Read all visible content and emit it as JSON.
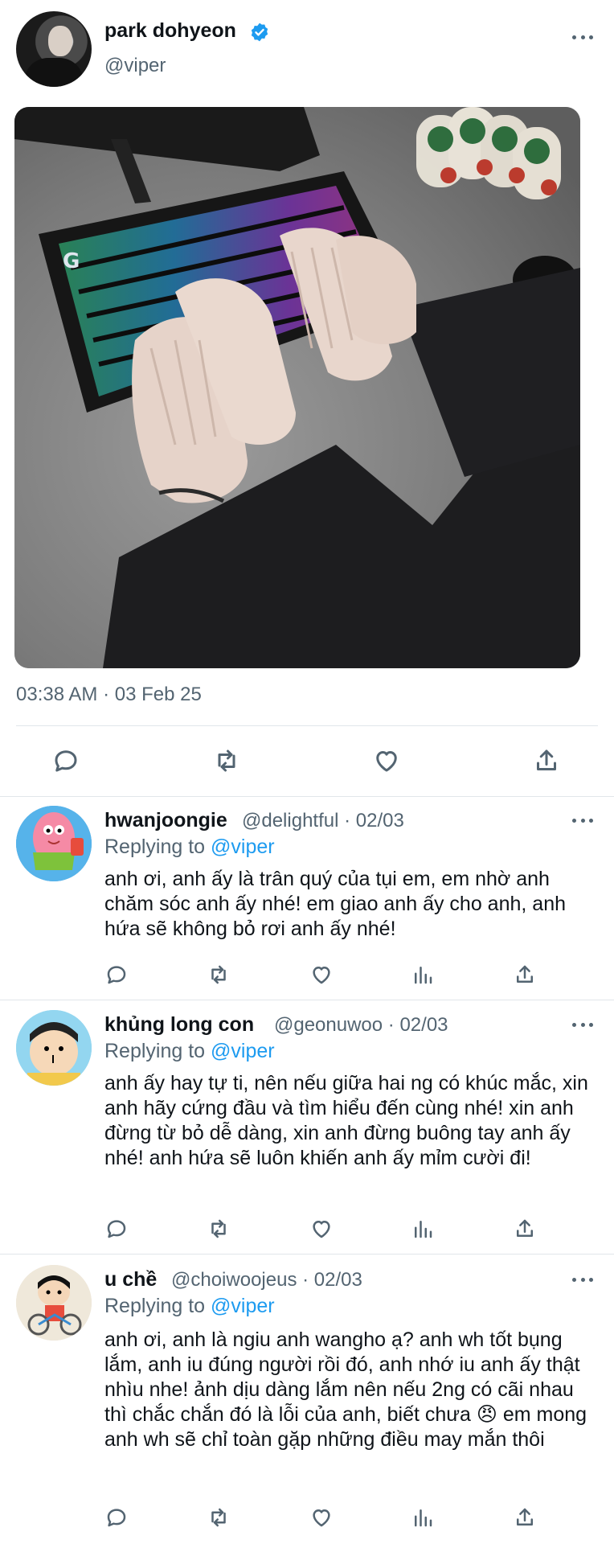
{
  "post": {
    "display_name": "park dohyeon",
    "handle": "@viper",
    "timestamp": "03:38 AM · 03 Feb 25",
    "image_alt": "Hands typing on an RGB mechanical keyboard"
  },
  "icons": {
    "verified": "verified-badge-icon",
    "more": "more-icon",
    "reply": "reply-icon",
    "retweet": "retweet-icon",
    "like": "heart-icon",
    "analytics": "analytics-icon",
    "share": "share-icon"
  },
  "colors": {
    "accent": "#1d9bf0",
    "muted": "#536471",
    "text": "#0f1419"
  },
  "replies": [
    {
      "name": "hwanjoongie",
      "meta": "@delightful · 02/03",
      "replying_label": "Replying to",
      "replying_to": "@viper",
      "text": "anh ơi, anh ấy là trân quý của tụi em, em nhờ anh chăm sóc anh ấy nhé! em giao anh ấy cho anh, anh hứa sẽ không bỏ rơi anh ấy nhé!"
    },
    {
      "name": "khủng long con",
      "meta": "@geonuwoo · 02/03",
      "replying_label": "Replying to",
      "replying_to": "@viper",
      "text": "anh ấy hay tự ti, nên nếu giữa hai ng có khúc mắc, xin anh hãy cứng đầu và tìm hiểu đến cùng nhé! xin anh đừng từ bỏ dễ dàng, xin anh đừng buông tay anh ấy nhé! anh hứa sẽ luôn khiến anh ấy mỉm cười đi!"
    },
    {
      "name": "u chề",
      "meta": "@choiwoojeus · 02/03",
      "replying_label": "Replying to",
      "replying_to": "@viper",
      "text": "anh ơi, anh là ngiu anh wangho ạ? anh wh tốt bụng lắm, anh iu đúng người rồi đó, anh nhớ iu anh ấy thật nhìu nhe! ảnh dịu dàng lắm nên nếu 2ng có cãi nhau thì chắc chắn đó là lỗi của anh, biết chưa 😠  em mong anh wh sẽ chỉ toàn gặp những điều may mắn thôi"
    }
  ]
}
